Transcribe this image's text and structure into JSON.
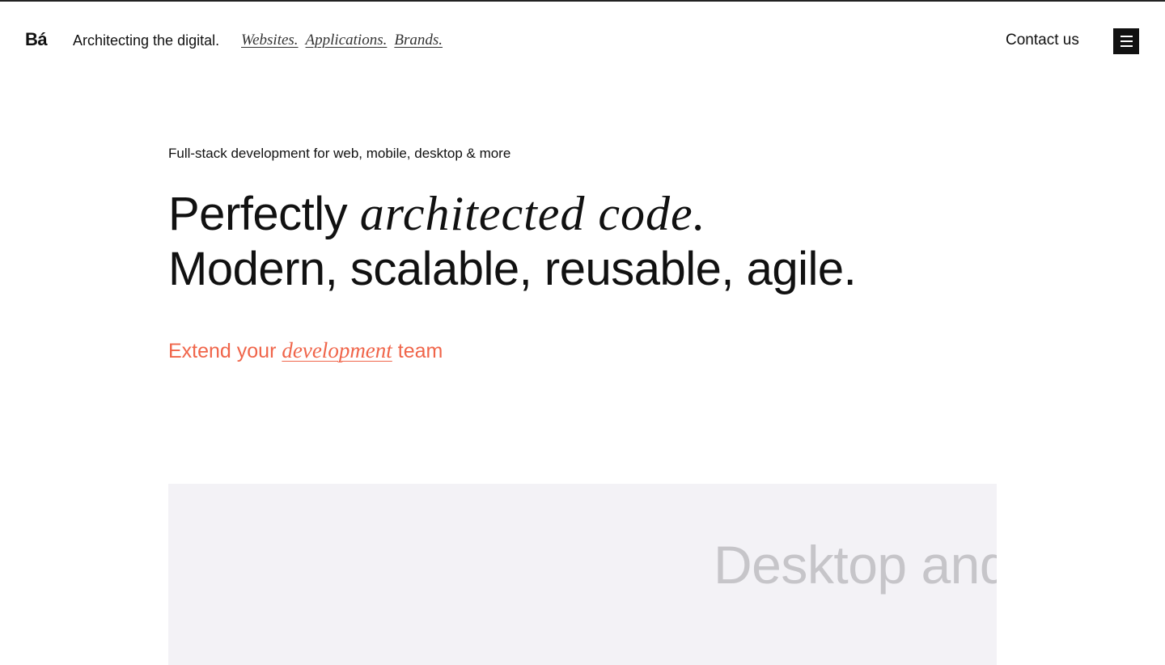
{
  "header": {
    "logo": "Bá",
    "tagline": "Architecting the digital.",
    "nav": [
      "Websites.",
      "Applications.",
      "Brands."
    ],
    "contact_label": "Contact us",
    "menu_icon": "hamburger-menu-icon"
  },
  "hero": {
    "subhead": "Full-stack development for web, mobile, desktop & more",
    "headline_line1_plain": "Perfectly ",
    "headline_line1_serif": "architected code.",
    "headline_line2": "Modern, scalable, reusable, agile."
  },
  "cta": {
    "part1": "Extend your ",
    "part2_serif": "development",
    "part3": " team"
  },
  "panel": {
    "text": "Desktop and"
  },
  "colors": {
    "accent": "#f0654a",
    "panel_bg": "#f3f2f6",
    "panel_text": "#c6c5c9",
    "text": "#111111"
  }
}
